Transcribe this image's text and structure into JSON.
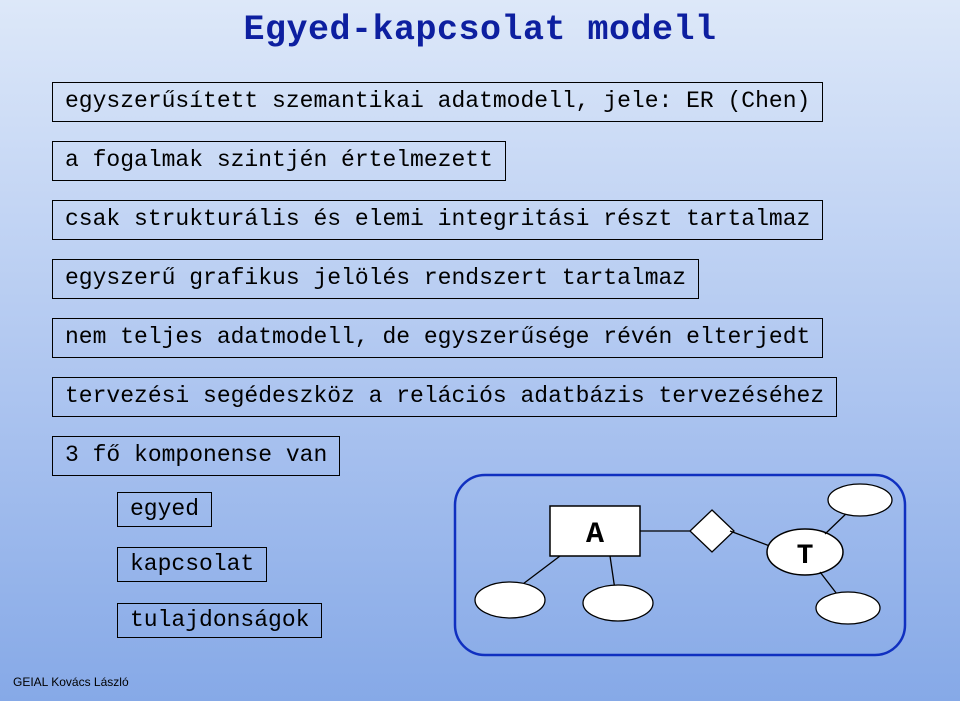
{
  "title": "Egyed-kapcsolat modell",
  "boxes": {
    "b1": "egyszerűsített szemantikai adatmodell, jele: ER (Chen)",
    "b2": "a fogalmak szintjén értelmezett",
    "b3": "csak strukturális és elemi integritási részt tartalmaz",
    "b4": "egyszerű grafikus jelölés rendszert tartalmaz",
    "b5": "nem teljes adatmodell, de egyszerűsége révén elterjedt",
    "b6": "tervezési segédeszköz a relációs adatbázis tervezéséhez",
    "b7": "3 fő komponense van"
  },
  "components": {
    "c1": "egyed",
    "c2": "kapcsolat",
    "c3": "tulajdonságok"
  },
  "diagram": {
    "entity_label": "A",
    "relationship_label": "",
    "attr_entity_label": "T"
  },
  "footer": "GEIAL Kovács László"
}
